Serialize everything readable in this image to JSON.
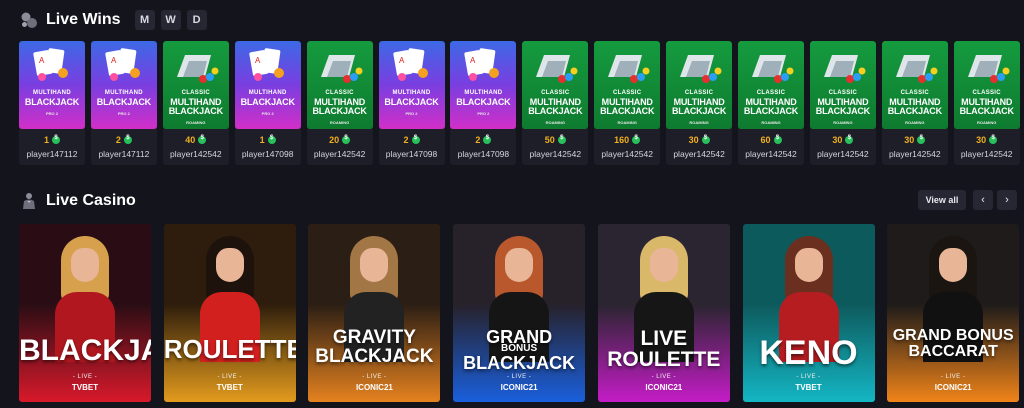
{
  "live_wins": {
    "title": "Live Wins",
    "icon": "chart-bubbles-icon",
    "periods": [
      "M",
      "W",
      "D"
    ],
    "items": [
      {
        "game": "mh",
        "amount": "1",
        "player": "player147112"
      },
      {
        "game": "mh",
        "amount": "2",
        "player": "player147112"
      },
      {
        "game": "cl",
        "amount": "40",
        "player": "player142542"
      },
      {
        "game": "mh",
        "amount": "1",
        "player": "player147098"
      },
      {
        "game": "cl",
        "amount": "20",
        "player": "player142542"
      },
      {
        "game": "mh",
        "amount": "2",
        "player": "player147098"
      },
      {
        "game": "mh",
        "amount": "2",
        "player": "player147098"
      },
      {
        "game": "cl",
        "amount": "50",
        "player": "player142542"
      },
      {
        "game": "cl",
        "amount": "160",
        "player": "player142542"
      },
      {
        "game": "cl",
        "amount": "30",
        "player": "player142542"
      },
      {
        "game": "cl",
        "amount": "60",
        "player": "player142542"
      },
      {
        "game": "cl",
        "amount": "30",
        "player": "player142542"
      },
      {
        "game": "cl",
        "amount": "30",
        "player": "player142542"
      },
      {
        "game": "cl",
        "amount": "30",
        "player": "player142542"
      }
    ],
    "games": {
      "mh": {
        "small": "MULTIHAND",
        "big": "BLACKJACK",
        "sub": "PRO 2"
      },
      "cl": {
        "small": "CLASSIC",
        "big": "MULTIHAND",
        "big2": "BLACKJACK",
        "sub": "ROAMING"
      }
    }
  },
  "live_casino": {
    "title": "Live Casino",
    "icon": "dealer-icon",
    "view_all": "View all",
    "prev_icon": "chevron-left-icon",
    "next_icon": "chevron-right-icon",
    "live_label": "- LIVE -",
    "cards": [
      {
        "line1": "BLACKJACK",
        "line2": "",
        "provider": "TVBET",
        "bg_top": "#2a0d14",
        "bg_bottom": "#d8192b",
        "hair": "#d6a04c",
        "body": "#b0171f",
        "size": 30
      },
      {
        "line1": "ROULETTE",
        "line2": "",
        "provider": "TVBET",
        "bg_top": "#2e1d0c",
        "bg_bottom": "#e39b1d",
        "hair": "#1d130c",
        "body": "#d2201f",
        "size": 26
      },
      {
        "line1": "GRAVITY",
        "line2": "BLACKJACK",
        "provider": "ICONIC21",
        "bg_top": "#2b1e14",
        "bg_bottom": "#e5821f",
        "hair": "#a37646",
        "body": "#222222",
        "size": 19
      },
      {
        "line1": "GRAND",
        "line2": "BLACKJACK",
        "extra": "BONUS",
        "provider": "ICONIC21",
        "bg_top": "#27212a",
        "bg_bottom": "#1a5fdc",
        "hair": "#b8582c",
        "body": "#151515",
        "size": 18
      },
      {
        "line1": "LIVE",
        "line2": "ROULETTE",
        "provider": "ICONIC21",
        "bg_top": "#2a2530",
        "bg_bottom": "#c41cc6",
        "hair": "#d9b86a",
        "body": "#161616",
        "size": 21
      },
      {
        "line1": "KENO",
        "line2": "",
        "provider": "TVBET",
        "bg_top": "#0d5a5c",
        "bg_bottom": "#14b6c4",
        "hair": "#6b2f1f",
        "body": "#b51d21",
        "size": 34
      },
      {
        "line1": "GRAND BONUS",
        "line2": "BACCARAT",
        "provider": "ICONIC21",
        "bg_top": "#1e1b1a",
        "bg_bottom": "#f08419",
        "hair": "#1a1511",
        "body": "#111111",
        "size": 16
      }
    ]
  }
}
